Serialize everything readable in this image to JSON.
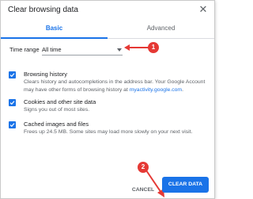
{
  "dialog": {
    "title": "Clear browsing data",
    "close_glyph": "✕"
  },
  "tabs": [
    {
      "label": "Basic",
      "active": true
    },
    {
      "label": "Advanced",
      "active": false
    }
  ],
  "time_range": {
    "label": "Time range",
    "selected": "All time"
  },
  "options": [
    {
      "title": "Browsing history",
      "desc_before": "Clears history and autocompletions in the address bar. Your Google Account may have other forms of browsing history at ",
      "desc_link": "myactivity.google.com",
      "desc_after": ".",
      "checked": true
    },
    {
      "title": "Cookies and other site data",
      "desc": "Signs you out of most sites.",
      "checked": true
    },
    {
      "title": "Cached images and files",
      "desc": "Frees up 24.5 MB. Some sites may load more slowly on your next visit.",
      "checked": true
    }
  ],
  "buttons": {
    "cancel": "CANCEL",
    "clear": "CLEAR DATA"
  },
  "annotations": {
    "badge1": "1",
    "badge2": "2",
    "color": "#e53935"
  },
  "colors": {
    "accent": "#1a73e8",
    "text": "#202124",
    "secondary": "#5f6368"
  }
}
